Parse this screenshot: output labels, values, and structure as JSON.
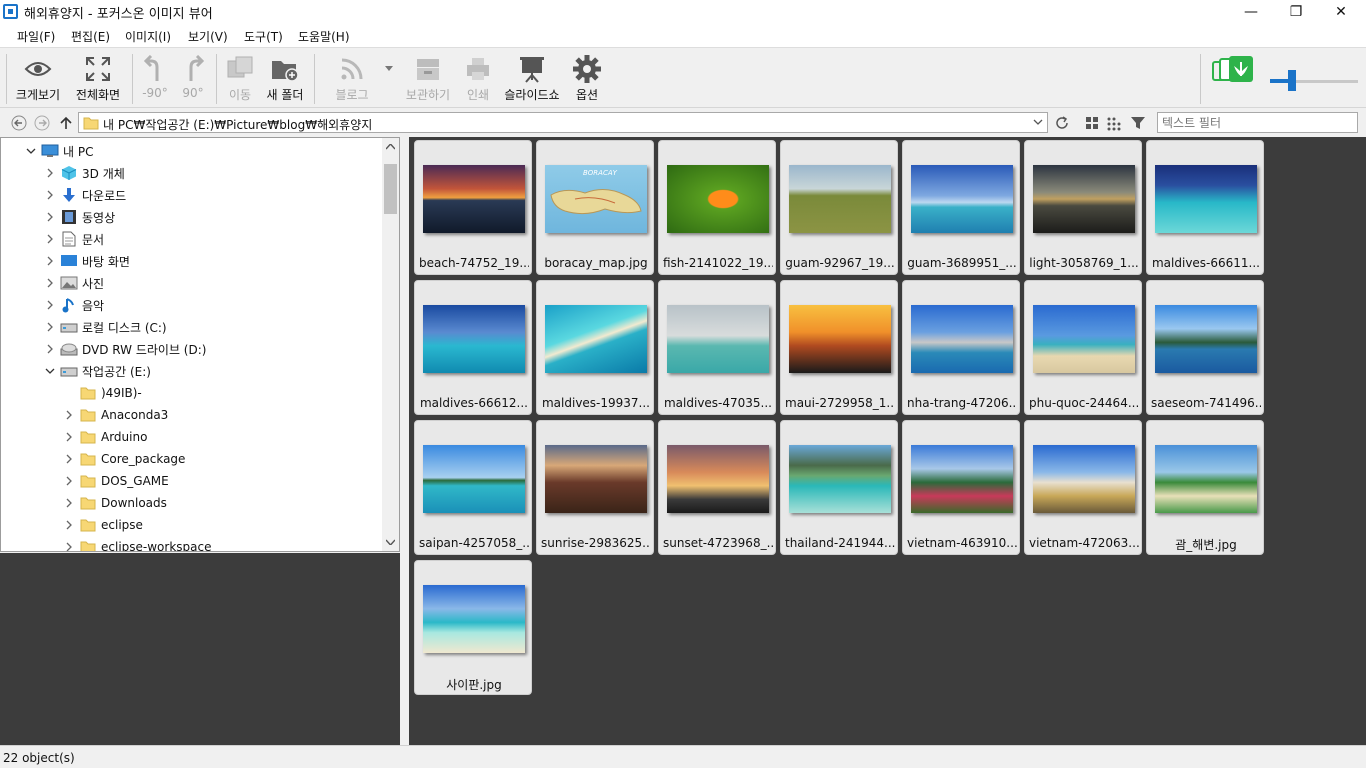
{
  "window": {
    "title": "해외휴양지 - 포커스온 이미지 뷰어",
    "minimize": "—",
    "restore": "❐",
    "close": "✕"
  },
  "menu": [
    "파일(F)",
    "편집(E)",
    "이미지(I)",
    "보기(V)",
    "도구(T)",
    "도움말(H)"
  ],
  "toolbar": {
    "view_large": "크게보기",
    "fullscreen": "전체화면",
    "rotate_left": "-90°",
    "rotate_right": "90°",
    "move": "이동",
    "new_folder": "새 폴더",
    "blog": "블로그",
    "archive": "보관하기",
    "print": "인쇄",
    "slideshow": "슬라이드쇼",
    "options": "옵션",
    "zoom_level": 0.2
  },
  "address": {
    "path": "내 PC₩작업공간 (E:)₩Picture₩blog₩해외휴양지",
    "filter_placeholder": "텍스트 필터"
  },
  "tree": [
    {
      "label": "내 PC",
      "icon": "pc-icon",
      "depth": 0,
      "expanded": true
    },
    {
      "label": "3D 개체",
      "icon": "cube-icon",
      "depth": 1
    },
    {
      "label": "다운로드",
      "icon": "download-icon",
      "depth": 1
    },
    {
      "label": "동영상",
      "icon": "video-icon",
      "depth": 1
    },
    {
      "label": "문서",
      "icon": "document-icon",
      "depth": 1
    },
    {
      "label": "바탕 화면",
      "icon": "desktop-icon",
      "depth": 1
    },
    {
      "label": "사진",
      "icon": "picture-icon",
      "depth": 1
    },
    {
      "label": "음악",
      "icon": "music-icon",
      "depth": 1
    },
    {
      "label": "로컬 디스크 (C:)",
      "icon": "drive-icon",
      "depth": 1
    },
    {
      "label": "DVD RW 드라이브 (D:)",
      "icon": "dvd-icon",
      "depth": 1
    },
    {
      "label": "작업공간 (E:)",
      "icon": "drive-icon",
      "depth": 1,
      "expanded": true
    },
    {
      "label": ")49IB)-",
      "icon": "folder-icon",
      "depth": 2,
      "noexp": true
    },
    {
      "label": "Anaconda3",
      "icon": "folder-icon",
      "depth": 2
    },
    {
      "label": "Arduino",
      "icon": "folder-icon",
      "depth": 2
    },
    {
      "label": "Core_package",
      "icon": "folder-icon",
      "depth": 2
    },
    {
      "label": "DOS_GAME",
      "icon": "folder-icon",
      "depth": 2
    },
    {
      "label": "Downloads",
      "icon": "folder-icon",
      "depth": 2
    },
    {
      "label": "eclipse",
      "icon": "folder-icon",
      "depth": 2
    },
    {
      "label": "eclipse-workspace",
      "icon": "folder-icon",
      "depth": 2
    }
  ],
  "thumbnails": [
    {
      "name": "beach-74752_19...",
      "scene": "sunset-pier"
    },
    {
      "name": "boracay_map.jpg",
      "scene": "map",
      "caption": "BORACAY"
    },
    {
      "name": "fish-2141022_19...",
      "scene": "fish"
    },
    {
      "name": "guam-92967_19...",
      "scene": "cannons"
    },
    {
      "name": "guam-3689951_...",
      "scene": "sea-sky"
    },
    {
      "name": "light-3058769_1...",
      "scene": "dusk-shore"
    },
    {
      "name": "maldives-66611...",
      "scene": "feet-water"
    },
    {
      "name": "maldives-66612...",
      "scene": "pier-huts"
    },
    {
      "name": "maldives-19937...",
      "scene": "aerial-beach"
    },
    {
      "name": "maldives-47035...",
      "scene": "cloudy-huts"
    },
    {
      "name": "maui-2729958_1...",
      "scene": "palm-sunset"
    },
    {
      "name": "nha-trang-47206...",
      "scene": "city-coast"
    },
    {
      "name": "phu-quoc-24464...",
      "scene": "palm-beach"
    },
    {
      "name": "saeseom-741496...",
      "scene": "island-coast"
    },
    {
      "name": "saipan-4257058_...",
      "scene": "island-sea"
    },
    {
      "name": "sunrise-2983625...",
      "scene": "mountain-sunrise"
    },
    {
      "name": "sunset-4723968_...",
      "scene": "clouds-sunset"
    },
    {
      "name": "thailand-241944...",
      "scene": "cliff-boat"
    },
    {
      "name": "vietnam-463910...",
      "scene": "flowers-hill"
    },
    {
      "name": "vietnam-472063...",
      "scene": "temple"
    },
    {
      "name": "괌_해변.jpg",
      "scene": "palms-green"
    },
    {
      "name": "사이판.jpg",
      "scene": "boat-beach"
    }
  ],
  "status": {
    "text": "22 object(s)"
  },
  "colors": {
    "accent": "#1a73c8",
    "grid_bg": "#3c3c3c",
    "folder": "#f7d774",
    "zoom_green": "#2eb34a"
  }
}
